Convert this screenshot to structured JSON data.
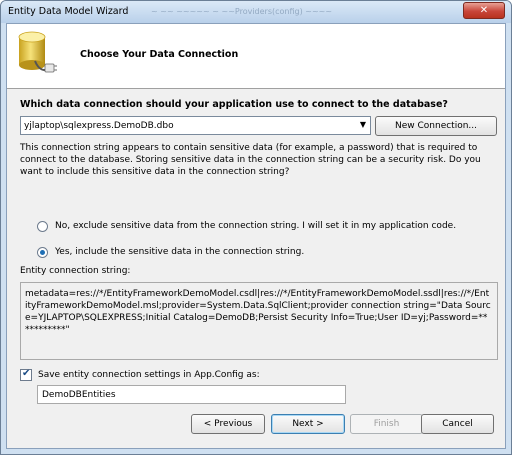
{
  "window": {
    "title": "Entity Data Model Wizard",
    "ghost_text": "~ ~~ ~~~~~ ~ ~~Providers(config) ~~~~",
    "close_glyph": "✕"
  },
  "header": {
    "heading": "Choose Your Data Connection"
  },
  "connection": {
    "question": "Which data connection should your application use to connect to the database?",
    "selected": "yjlaptop\\sqlexpress.DemoDB.dbo",
    "dropdown_arrow": "▼",
    "new_connection_label": "New Connection..."
  },
  "warning": "This connection string appears to contain sensitive data (for example, a password) that is required to connect to the database. Storing sensitive data in the connection string can be a security risk. Do you want to include this sensitive data in the connection string?",
  "options": {
    "exclude": "No, exclude sensitive data from the connection string. I will set it in my application code.",
    "include": "Yes, include the sensitive data in the connection string.",
    "selected": "include"
  },
  "entity_connection": {
    "label": "Entity connection string:",
    "value": "metadata=res://*/EntityFrameworkDemoModel.csdl|res://*/EntityFrameworkDemoModel.ssdl|res://*/EntityFrameworkDemoModel.msl;provider=System.Data.SqlClient;provider connection string=\"Data Source=YJLAPTOP\\SQLEXPRESS;Initial Catalog=DemoDB;Persist Security Info=True;User ID=yj;Password=***********\""
  },
  "save_settings": {
    "label": "Save entity connection settings in App.Config as:",
    "checked": true,
    "check_glyph": "✔",
    "name": "DemoDBEntities"
  },
  "buttons": {
    "previous": "< Previous",
    "next": "Next >",
    "finish": "Finish",
    "cancel": "Cancel"
  },
  "icon": "database-plug-icon"
}
